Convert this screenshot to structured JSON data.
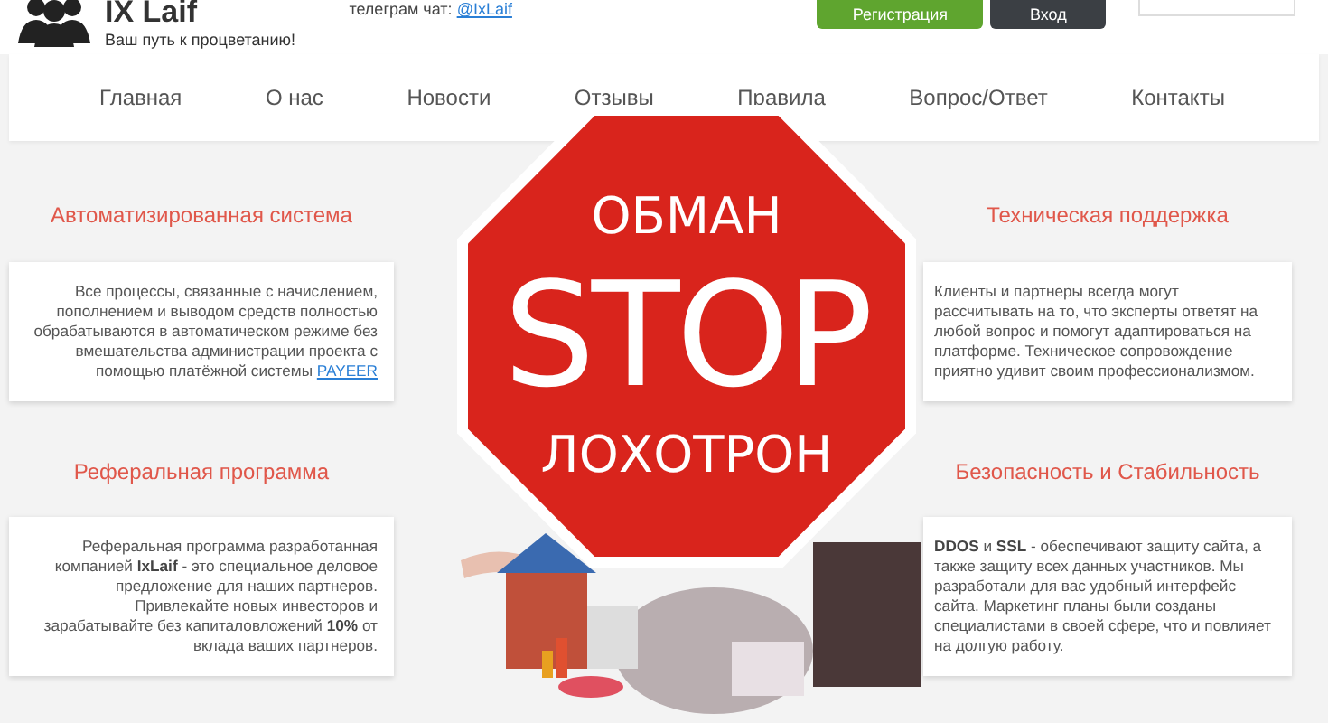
{
  "header": {
    "logo": "IX Laif",
    "tagline": "Ваш путь к процветанию!",
    "telegram_label": "телеграм чат:",
    "telegram_link": "@IxLaif",
    "buttons": [
      {
        "label": "Регистрация",
        "kind": "primary"
      },
      {
        "label": "Вход",
        "kind": "dark"
      }
    ]
  },
  "nav": [
    {
      "label": "Главная"
    },
    {
      "label": "О нас"
    },
    {
      "label": "Новости"
    },
    {
      "label": "Отзывы"
    },
    {
      "label": "Правила"
    },
    {
      "label": "Вопрос/Ответ"
    },
    {
      "label": "Контакты"
    }
  ],
  "columns": [
    {
      "features": [
        {
          "title": "Автоматизированная система",
          "text": "Все процессы, связанные с начислением, пополнением и выводом средств полностью обрабатываются в автоматическом режиме без вмешательства администрации проекта с помощью платёжной системы",
          "link": "PAYEER"
        },
        {
          "title": "Реферальная программа",
          "text": "Реферальная программа разработанная компанией **IxLaif** - это специальное деловое предложение для наших партнеров. Привлекайте новых инвесторов и зарабатывайте без капиталовложений **10%** от вклада ваших партнеров."
        }
      ]
    },
    {
      "features": [
        {
          "title": "Техническая поддержка",
          "text": "Клиенты и партнеры всегда могут рассчитывать на то, что эксперты ответят на любой вопрос и помогут адаптироваться на платформе. Техническое сопровождение приятно удивит своим профессионализмом."
        },
        {
          "title": "Безопасность и Стабильность",
          "text": "**DDOS** и **SSL** - обеспечивают защиту сайта, а также защиту всех данных участников. Мы разработали для вас удобный интерфейс сайта. Маркетинг планы были созданы специалистами в своей сфере, что и повлияет на долгую работу."
        }
      ]
    }
  ],
  "stop_sign": {
    "top_text": "ОБМАН",
    "main_text": "STOP",
    "bottom_text": "ЛОХОТРОН"
  }
}
